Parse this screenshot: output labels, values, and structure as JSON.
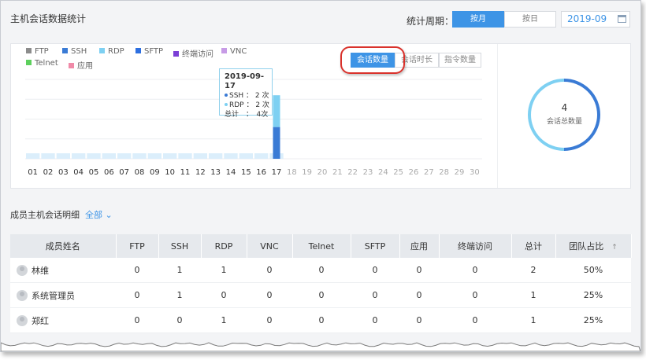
{
  "header": {
    "title": "主机会话数据统计",
    "period_label": "统计周期：",
    "period_options": [
      "按月",
      "按日"
    ],
    "selected_period": "按月",
    "month_value": "2019-09"
  },
  "colors": {
    "accent": "#3d94e6",
    "ssh": "#3a7bd5",
    "rdp": "#7ed0f2",
    "highlight_ring": "#d9312b"
  },
  "legend": [
    {
      "label": "FTP",
      "color": "#8c8c8c"
    },
    {
      "label": "SSH",
      "color": "#3a7bd5"
    },
    {
      "label": "RDP",
      "color": "#7ed0f2"
    },
    {
      "label": "SFTP",
      "color": "#2d6fe0"
    },
    {
      "label": "终端访问",
      "color": "#7b3fd6"
    },
    {
      "label": "VNC",
      "color": "#c79be6"
    },
    {
      "label": "Telnet",
      "color": "#5dd05d"
    },
    {
      "label": "应用",
      "color": "#f08aa8"
    }
  ],
  "metric_buttons": [
    "会话数量",
    "会话时长",
    "指令数量"
  ],
  "selected_metric": "会话数量",
  "tooltip": {
    "date": "2019-09-17",
    "ssh_line": "SSH ： 2 次",
    "rdp_line": "RDP ： 2 次",
    "total_line": "总计　：　4次"
  },
  "chart_data": {
    "type": "bar",
    "stacked": true,
    "categories": [
      "01",
      "02",
      "03",
      "04",
      "05",
      "06",
      "07",
      "08",
      "09",
      "10",
      "11",
      "12",
      "13",
      "14",
      "15",
      "16",
      "17",
      "18",
      "19",
      "20",
      "21",
      "22",
      "23",
      "24",
      "25",
      "26",
      "27",
      "28",
      "29",
      "30"
    ],
    "series": [
      {
        "name": "SSH",
        "values": [
          0,
          0,
          0,
          0,
          0,
          0,
          0,
          0,
          0,
          0,
          0,
          0,
          0,
          0,
          0,
          0,
          2,
          0,
          0,
          0,
          0,
          0,
          0,
          0,
          0,
          0,
          0,
          0,
          0,
          0
        ]
      },
      {
        "name": "RDP",
        "values": [
          0,
          0,
          0,
          0,
          0,
          0,
          0,
          0,
          0,
          0,
          0,
          0,
          0,
          0,
          0,
          0,
          2,
          0,
          0,
          0,
          0,
          0,
          0,
          0,
          0,
          0,
          0,
          0,
          0,
          0
        ]
      }
    ],
    "data_through_index": 16,
    "grid": true
  },
  "donut": {
    "total": "4",
    "caption": "会话总数量",
    "slices": [
      {
        "name": "SSH",
        "value": 2,
        "color": "#3a7bd5"
      },
      {
        "name": "RDP",
        "value": 2,
        "color": "#7ed0f2"
      }
    ]
  },
  "members": {
    "section_title": "成员主机会话明细",
    "filter_label": "全部 ⌄",
    "columns": [
      "成员姓名",
      "FTP",
      "SSH",
      "RDP",
      "VNC",
      "Telnet",
      "SFTP",
      "应用",
      "终端访问",
      "总计",
      "团队占比"
    ],
    "sort_icon": "↑",
    "rows": [
      {
        "name": "林维",
        "cells": [
          "0",
          "1",
          "1",
          "0",
          "0",
          "0",
          "0",
          "0",
          "2",
          "50%"
        ]
      },
      {
        "name": "系统管理员",
        "cells": [
          "0",
          "1",
          "0",
          "0",
          "0",
          "0",
          "0",
          "0",
          "1",
          "25%"
        ]
      },
      {
        "name": "郑红",
        "cells": [
          "0",
          "0",
          "1",
          "0",
          "0",
          "0",
          "0",
          "0",
          "1",
          "25%"
        ]
      }
    ]
  }
}
